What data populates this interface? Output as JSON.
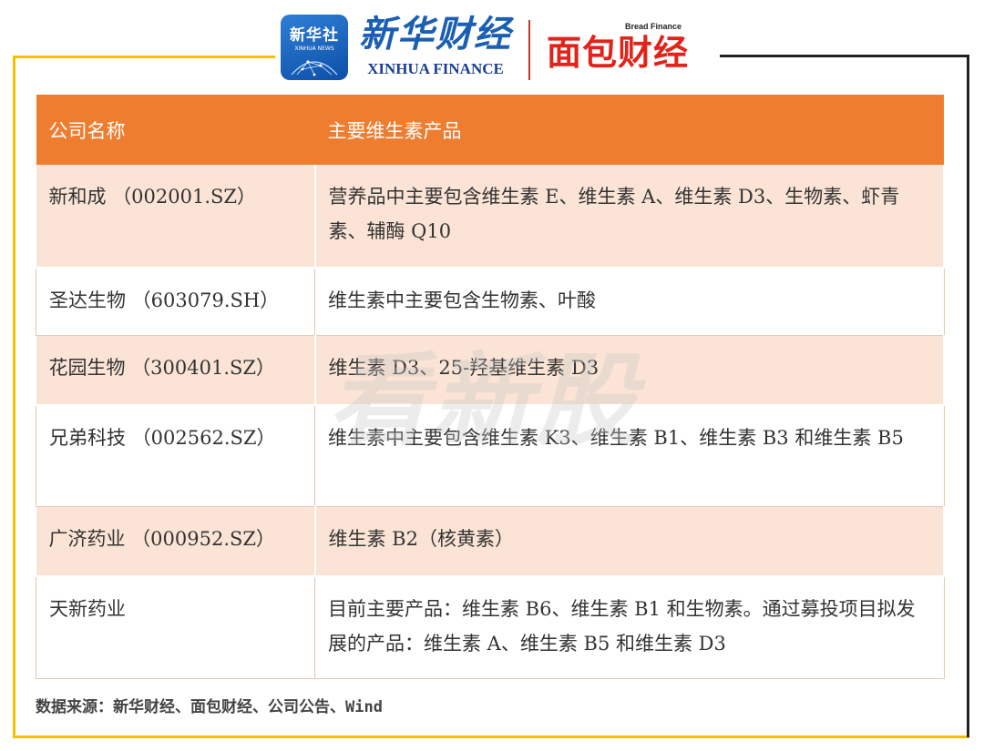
{
  "header": {
    "badge_title": "新华社",
    "badge_sub": "XINHUA NEWS",
    "xinhua_cn": "新华财经",
    "xinhua_en": "XINHUA FINANCE",
    "bread_en": "Bread Finance",
    "bread_cn": "面包财经",
    "colors": {
      "xinhua_blue": "#1a5fb4",
      "bread_red": "#e2231a",
      "frame_yellow": "#f2c200"
    }
  },
  "table": {
    "header_color": "#ee7d2f",
    "headers": [
      "公司名称",
      "主要维生素产品"
    ],
    "rows": [
      {
        "company": "新和成 （002001.SZ）",
        "products": "营养品中主要包含维生素 E、维生素 A、维生素 D3、生物素、虾青素、辅酶 Q10"
      },
      {
        "company": "圣达生物 （603079.SH）",
        "products": "维生素中主要包含生物素、叶酸"
      },
      {
        "company": "花园生物 （300401.SZ）",
        "products": "维生素 D3、25-羟基维生素 D3"
      },
      {
        "company": "兄弟科技 （002562.SZ）",
        "products": "维生素中主要包含维生素 K3、维生素 B1、维生素 B3 和维生素 B5"
      },
      {
        "company": "广济药业 （000952.SZ）",
        "products": "维生素 B2（核黄素）"
      },
      {
        "company": "天新药业",
        "products": "目前主要产品：维生素 B6、维生素 B1 和生物素。通过募投项目拟发展的产品：维生素 A、维生素 B5 和维生素 D3"
      }
    ]
  },
  "source": "数据来源：新华财经、面包财经、公司公告、Wind",
  "watermark": "看新股"
}
